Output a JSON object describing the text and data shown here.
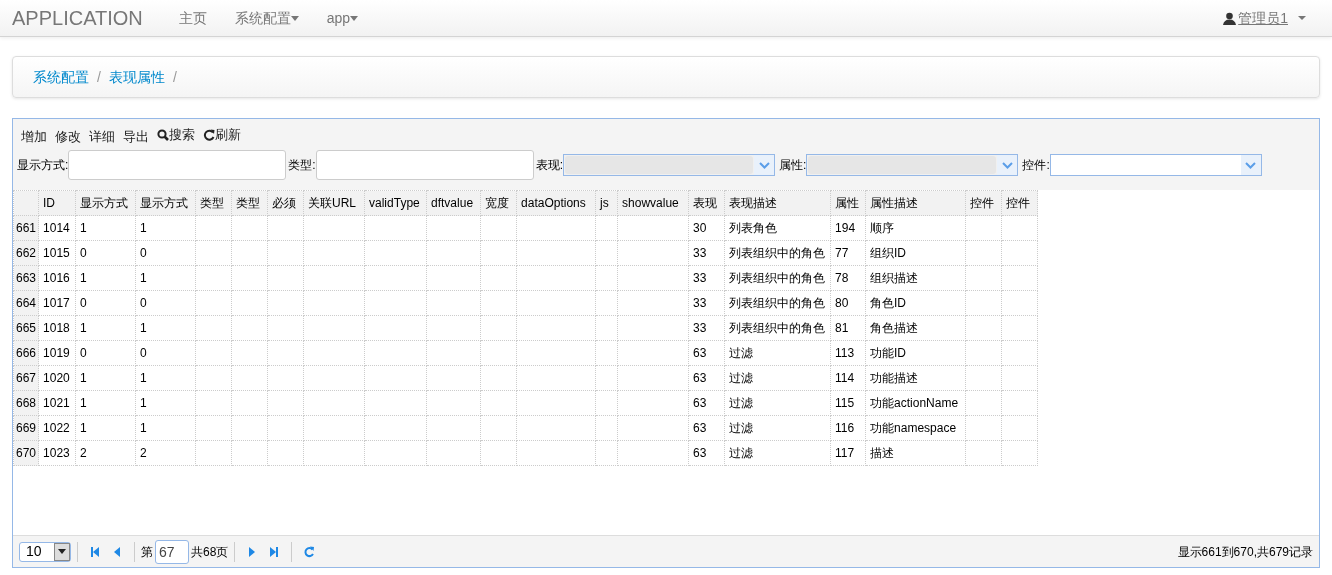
{
  "navbar": {
    "brand": "APPLICATION",
    "items": [
      {
        "label": "主页",
        "dropdown": false
      },
      {
        "label": "系统配置",
        "dropdown": true
      },
      {
        "label": "app",
        "dropdown": true
      }
    ],
    "user": "管理员1"
  },
  "breadcrumb": [
    {
      "label": "系统配置",
      "separator": "/"
    },
    {
      "label": "表现属性",
      "separator": "/"
    }
  ],
  "toolbar": [
    {
      "label": "增加",
      "kind": "plain"
    },
    {
      "label": "修改",
      "kind": "plain"
    },
    {
      "label": "详细",
      "kind": "plain"
    },
    {
      "label": "导出",
      "kind": "plain"
    },
    {
      "label": "搜索",
      "kind": "search"
    },
    {
      "label": "刷新",
      "kind": "refresh"
    }
  ],
  "filters": [
    {
      "label": "显示方式:",
      "kind": "text"
    },
    {
      "label": "类型:",
      "kind": "text"
    },
    {
      "label": "表现:",
      "kind": "select",
      "disabled": true
    },
    {
      "label": "属性:",
      "kind": "select",
      "disabled": true
    },
    {
      "label": "控件:",
      "kind": "select",
      "disabled": false
    }
  ],
  "table": {
    "columns": [
      "ID",
      "显示方式",
      "显示方式",
      "类型",
      "类型",
      "必须",
      "关联URL",
      "validType",
      "dftvalue",
      "宽度",
      "dataOptions",
      "js",
      "showvalue",
      "表现",
      "表现描述",
      "属性",
      "属性描述",
      "控件",
      "控件"
    ],
    "rows": [
      {
        "row_number": "661",
        "cells": [
          "1014",
          "1",
          "1",
          null,
          null,
          null,
          null,
          null,
          null,
          null,
          null,
          null,
          null,
          "30",
          "列表角色",
          "194",
          "顺序",
          null,
          null
        ]
      },
      {
        "row_number": "662",
        "cells": [
          "1015",
          "0",
          "0",
          null,
          null,
          null,
          null,
          null,
          null,
          null,
          null,
          null,
          null,
          "33",
          "列表组织中的角色",
          "77",
          "组织ID",
          null,
          null
        ]
      },
      {
        "row_number": "663",
        "cells": [
          "1016",
          "1",
          "1",
          null,
          null,
          null,
          null,
          null,
          null,
          null,
          null,
          null,
          null,
          "33",
          "列表组织中的角色",
          "78",
          "组织描述",
          null,
          null
        ]
      },
      {
        "row_number": "664",
        "cells": [
          "1017",
          "0",
          "0",
          null,
          null,
          null,
          null,
          null,
          null,
          null,
          null,
          null,
          null,
          "33",
          "列表组织中的角色",
          "80",
          "角色ID",
          null,
          null
        ]
      },
      {
        "row_number": "665",
        "cells": [
          "1018",
          "1",
          "1",
          null,
          null,
          null,
          null,
          null,
          null,
          null,
          null,
          null,
          null,
          "33",
          "列表组织中的角色",
          "81",
          "角色描述",
          null,
          null
        ]
      },
      {
        "row_number": "666",
        "cells": [
          "1019",
          "0",
          "0",
          null,
          null,
          null,
          null,
          null,
          null,
          null,
          null,
          null,
          null,
          "63",
          "过滤",
          "113",
          "功能ID",
          null,
          null
        ]
      },
      {
        "row_number": "667",
        "cells": [
          "1020",
          "1",
          "1",
          null,
          null,
          null,
          null,
          null,
          null,
          null,
          null,
          null,
          null,
          "63",
          "过滤",
          "114",
          "功能描述",
          null,
          null
        ]
      },
      {
        "row_number": "668",
        "cells": [
          "1021",
          "1",
          "1",
          null,
          null,
          null,
          null,
          null,
          null,
          null,
          null,
          null,
          null,
          "63",
          "过滤",
          "115",
          "功能actionName",
          null,
          null
        ]
      },
      {
        "row_number": "669",
        "cells": [
          "1022",
          "1",
          "1",
          null,
          null,
          null,
          null,
          null,
          null,
          null,
          null,
          null,
          null,
          "63",
          "过滤",
          "116",
          "功能namespace",
          null,
          null
        ]
      },
      {
        "row_number": "670",
        "cells": [
          "1023",
          "2",
          "2",
          null,
          null,
          null,
          null,
          null,
          null,
          null,
          null,
          null,
          null,
          "63",
          "过滤",
          "117",
          "描述",
          null,
          null
        ]
      }
    ]
  },
  "pager": {
    "page_size": "10",
    "page_prefix": "第",
    "page": "67",
    "page_total": "共68页",
    "summary": "显示661到670,共679记录"
  }
}
